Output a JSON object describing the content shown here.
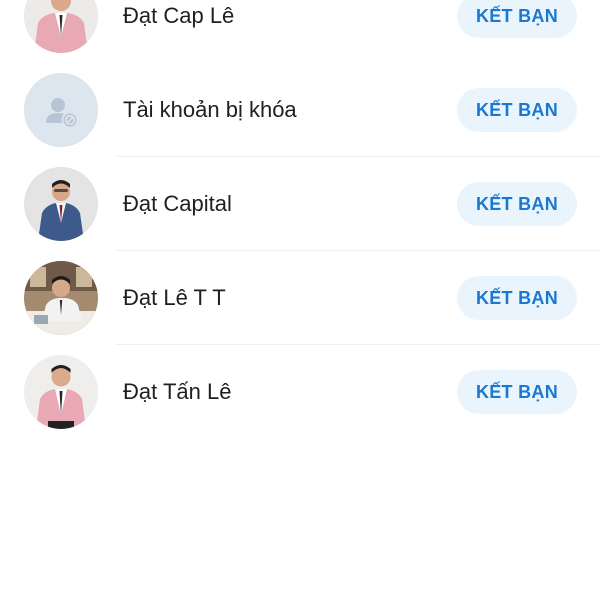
{
  "contacts": [
    {
      "name": "Đạt Cap Lê",
      "button_label": "KẾT BẠN",
      "avatar": "photo-man-pink-suit"
    },
    {
      "name": "Tài khoản bị khóa",
      "button_label": "KẾT BẠN",
      "avatar": "locked-account-icon"
    },
    {
      "name": "Đạt Capital",
      "button_label": "KẾT BẠN",
      "avatar": "photo-man-blue-suit"
    },
    {
      "name": "Đạt Lê T T",
      "button_label": "KẾT BẠN",
      "avatar": "photo-man-at-desk"
    },
    {
      "name": "Đạt Tấn Lê",
      "button_label": "KẾT BẠN",
      "avatar": "photo-man-pink-suit"
    }
  ],
  "colors": {
    "button_bg": "#eaf4fd",
    "button_text": "#1a78d0",
    "name_text": "#1d1f22",
    "locked_avatar_bg": "#dde5ee",
    "locked_icon": "#b7c4d3"
  }
}
